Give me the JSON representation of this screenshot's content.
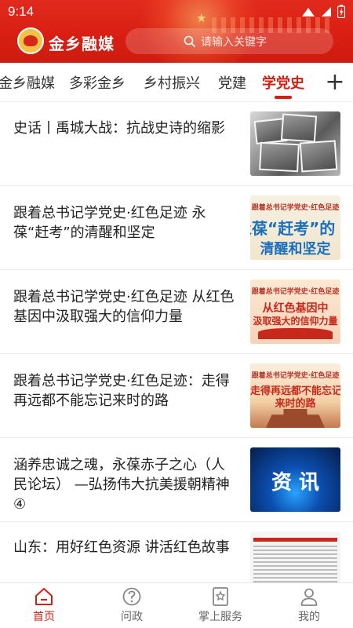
{
  "status_bar": {
    "time": "9:14"
  },
  "header": {
    "app_name": "金乡融媒",
    "search_placeholder": "请输入关键字"
  },
  "tabs": [
    {
      "label": "金乡融媒"
    },
    {
      "label": "多彩金乡"
    },
    {
      "label": "乡村振兴"
    },
    {
      "label": "党建"
    },
    {
      "label": "学党史",
      "active": true
    }
  ],
  "tab_add_label": "+",
  "articles": [
    {
      "title": "史话丨禹城大战：抗战史诗的缩影",
      "thumb_caption": []
    },
    {
      "title": "跟着总书记学党史·红色足迹 永葆“赶考”的清醒和坚定",
      "thumb_caption": [
        "跟着总书记学党史·红色足迹",
        "永葆“赶考”的",
        "清醒和坚定"
      ]
    },
    {
      "title": "跟着总书记学党史·红色足迹 从红色基因中汲取强大的信仰力量",
      "thumb_caption": [
        "跟着总书记学党史·红色足迹",
        "从红色基因中",
        "汲取强大的信仰力量"
      ]
    },
    {
      "title": "跟着总书记学党史·红色足迹：走得再远都不能忘记来时的路",
      "thumb_caption": [
        "跟着总书记学党史·红色足迹",
        "走得再远都不能忘记",
        "来时的路"
      ]
    },
    {
      "title": "涵养忠诚之魂，永葆赤子之心（人民论坛） —弘扬伟大抗美援朝精神④",
      "thumb_caption": [
        "资 讯"
      ]
    },
    {
      "title": "山东：用好红色资源 讲活红色故事",
      "thumb_caption": []
    }
  ],
  "bottom_nav": [
    {
      "label": "首页",
      "icon": "home-icon",
      "active": true
    },
    {
      "label": "问政",
      "icon": "question-icon"
    },
    {
      "label": "掌上服务",
      "icon": "service-icon"
    },
    {
      "label": "我的",
      "icon": "profile-icon"
    }
  ],
  "colors": {
    "brand_red": "#d81e12",
    "text": "#222222",
    "muted": "#666666"
  }
}
